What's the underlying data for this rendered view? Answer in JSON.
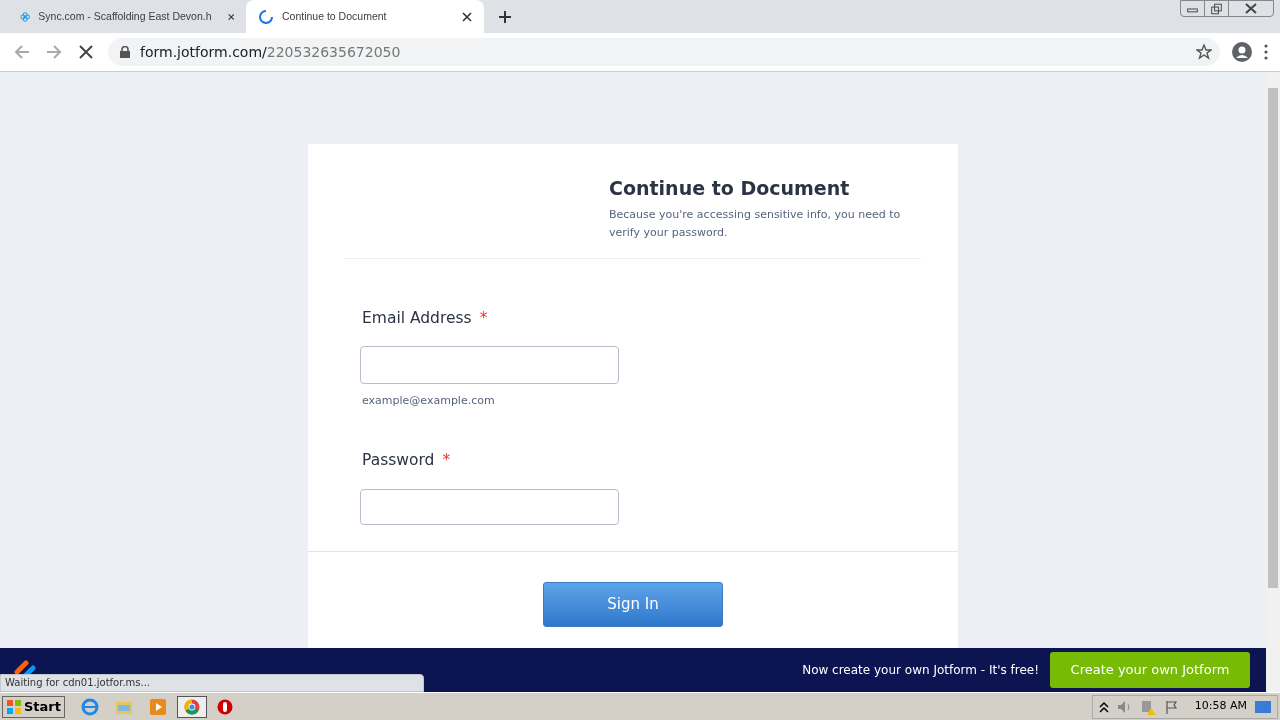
{
  "browser": {
    "tabs": [
      {
        "title": "Sync.com - Scaffolding East Devon.h",
        "selected": false,
        "loading": false
      },
      {
        "title": "Continue to Document",
        "selected": true,
        "loading": true
      }
    ],
    "url": {
      "host": "form.jotform.com/",
      "path": "220532635672050"
    },
    "loading": true
  },
  "form": {
    "title": "Continue to Document",
    "subtitle": "Because you're accessing sensitive info, you need to verify your password.",
    "fields": [
      {
        "label": "Email Address",
        "required_mark": "*",
        "kind": "email",
        "sublabel": "example@example.com"
      },
      {
        "label": "Password",
        "required_mark": "*",
        "kind": "password"
      }
    ],
    "submit": "Sign In"
  },
  "banner": {
    "message": "Now create your own Jotform - It's free!",
    "button": "Create your own Jotform"
  },
  "status_bubble": "Waiting for cdn01.jotfor.ms...",
  "taskbar": {
    "start": "Start",
    "clock": "10:58 AM"
  }
}
